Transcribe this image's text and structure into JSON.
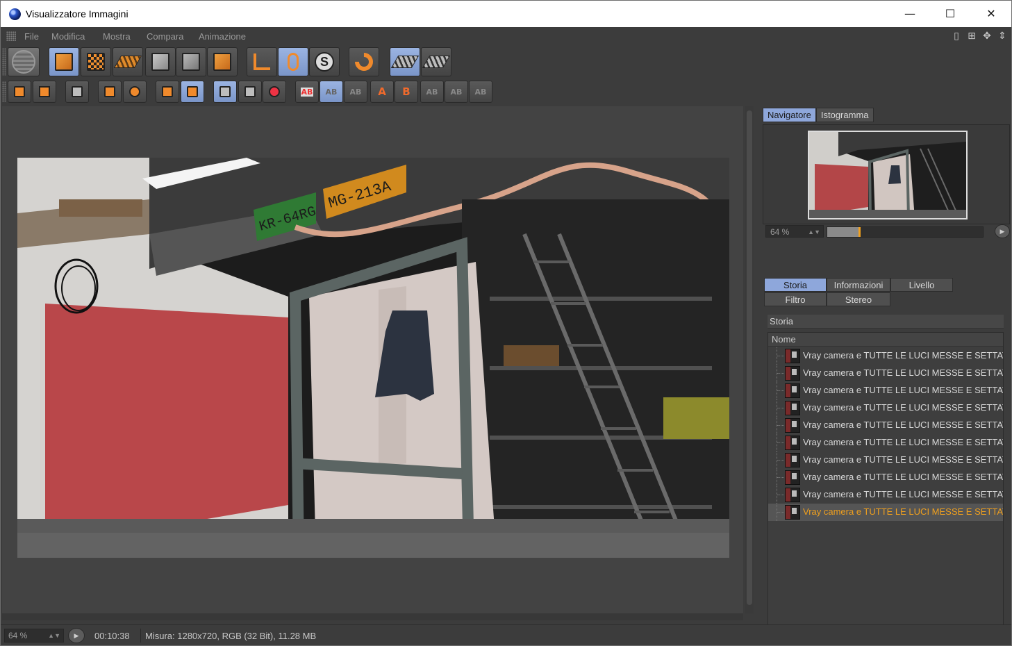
{
  "window": {
    "title": "Visualizzatore Immagini",
    "minimize": "—",
    "maximize": "☐",
    "close": "✕"
  },
  "menu": [
    "File",
    "Modifica",
    "Mostra",
    "Compara",
    "Animazione"
  ],
  "navigator": {
    "tabs": [
      "Navigatore",
      "Istogramma"
    ],
    "active_tab": "Navigatore",
    "zoom": "64 %",
    "zoom_percent": 64
  },
  "panel": {
    "subtabs": [
      "Storia",
      "Informazioni",
      "Livello",
      "Filtro",
      "Stereo"
    ],
    "active_subtab": "Storia",
    "section_title": "Storia",
    "column_header": "Nome",
    "history": [
      "Vray camera e TUTTE LE LUCI MESSE E SETTATI",
      "Vray camera e TUTTE LE LUCI MESSE E SETTATI",
      "Vray camera e TUTTE LE LUCI MESSE E SETTATI",
      "Vray camera e TUTTE LE LUCI MESSE E SETTATI",
      "Vray camera e TUTTE LE LUCI MESSE E SETTATI",
      "Vray camera e TUTTE LE LUCI MESSE E SETTATI",
      "Vray camera e TUTTE LE LUCI MESSE E SETTATI",
      "Vray camera e TUTTE LE LUCI MESSE E SETTATI",
      "Vray camera e TUTTE LE LUCI MESSE E SETTATI",
      "Vray camera e TUTTE LE LUCI MESSE E SETTATI"
    ],
    "selected_index": 9
  },
  "render_scene": {
    "plate_green": "KR-64RG",
    "plate_orange": "MG-213A"
  },
  "status": {
    "zoom": "64 %",
    "time": "00:10:38",
    "info": "Misura: 1280x720, RGB (32 Bit), 11.28 MB"
  },
  "colors": {
    "accent_blue": "#8ea7db",
    "selected_orange": "#f0a01e",
    "panel_bg": "#3c3c3c"
  }
}
